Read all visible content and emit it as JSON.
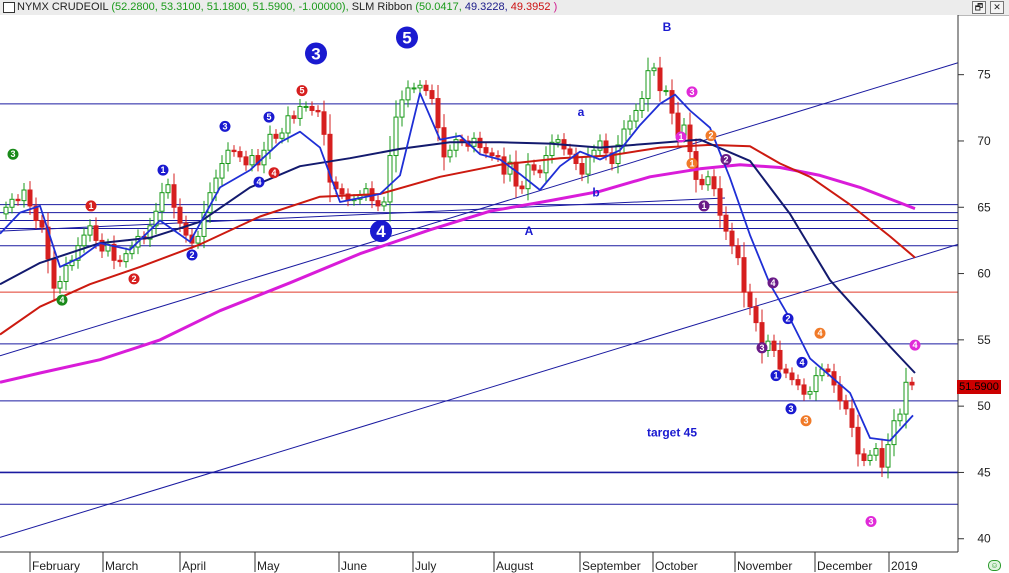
{
  "window": {
    "symbol_label": "NYMX CRUDEOIL",
    "ohlc_text": "(52.2800, 53.3100, 51.1800, 51.5900, -1.00000),",
    "ribbon_label": "SLM Ribbon",
    "ribbon_v1": "(50.0417,",
    "ribbon_v2": "49.3228,",
    "ribbon_v3": "49.3952",
    "ribbon_close": ")",
    "restore_label": "🗗",
    "close_label": "✕",
    "status_icon": "☺"
  },
  "colors": {
    "up": "#1a9a1a",
    "down": "#d61f1f",
    "navy": "#131a6e",
    "blue": "#1f2fd6",
    "red_ma": "#cc1a10",
    "magenta": "#d91cd9",
    "hline": "#1a1aa0",
    "channel": "#1a1aa0"
  },
  "chart_data": {
    "type": "line",
    "title": "",
    "xlabel": "",
    "ylabel": "",
    "ylim": [
      39.0,
      79.5
    ],
    "y_ticks": [
      40,
      45,
      50,
      55,
      60,
      65,
      70,
      75
    ],
    "months": [
      "February",
      "March",
      "April",
      "May",
      "June",
      "July",
      "August",
      "September",
      "October",
      "November",
      "December",
      "2019"
    ],
    "last_price": "51.5900",
    "horizontal_levels": [
      72.8,
      65.2,
      64.6,
      64.0,
      63.4,
      62.1,
      54.7,
      50.4,
      45.0,
      42.6
    ],
    "red_level": 58.6,
    "channel_lines": [
      {
        "from": [
          0,
          53.8
        ],
        "to": [
          958,
          75.9
        ]
      },
      {
        "from": [
          0,
          40.1
        ],
        "to": [
          958,
          62.2
        ]
      }
    ],
    "b_line": {
      "from": [
        0,
        63.2
      ],
      "to": [
        725,
        65.7
      ]
    },
    "series": [
      {
        "name": "",
        "role": "ma_magenta",
        "x": [
          0,
          40,
          100,
          160,
          220,
          290,
          360,
          430,
          490,
          550,
          600,
          650,
          700,
          740,
          780,
          820,
          860,
          915
        ],
        "values": [
          51.8,
          52.5,
          53.5,
          55.0,
          57.2,
          59.3,
          61.5,
          63.3,
          64.7,
          65.5,
          66.2,
          67.3,
          67.9,
          68.2,
          68.0,
          67.4,
          66.5,
          64.9
        ]
      },
      {
        "name": "",
        "role": "ma_red",
        "x": [
          0,
          40,
          90,
          140,
          200,
          260,
          320,
          380,
          440,
          500,
          560,
          610,
          660,
          710,
          750,
          780,
          810,
          850,
          890,
          915
        ],
        "values": [
          55.4,
          57.5,
          59.2,
          60.5,
          62.2,
          64.3,
          65.8,
          66.0,
          67.3,
          68.2,
          68.7,
          68.9,
          69.5,
          69.7,
          69.6,
          68.3,
          67.3,
          65.2,
          62.8,
          61.2
        ]
      },
      {
        "name": "",
        "role": "ma_navy",
        "x": [
          0,
          40,
          100,
          150,
          200,
          250,
          300,
          350,
          400,
          450,
          500,
          550,
          600,
          650,
          700,
          750,
          790,
          830,
          860,
          890,
          915
        ],
        "values": [
          59.2,
          60.8,
          62.3,
          62.7,
          63.9,
          66.5,
          68.1,
          68.7,
          69.4,
          69.9,
          69.9,
          69.8,
          69.5,
          69.8,
          70.1,
          68.5,
          64.5,
          59.5,
          57.0,
          54.5,
          52.5
        ]
      },
      {
        "name": "",
        "role": "ma_blue",
        "x": [
          0,
          20,
          40,
          60,
          80,
          100,
          130,
          160,
          190,
          220,
          250,
          280,
          300,
          320,
          340,
          360,
          380,
          400,
          420,
          440,
          460,
          480,
          500,
          520,
          540,
          560,
          580,
          600,
          620,
          640,
          660,
          675,
          690,
          710,
          730,
          750,
          770,
          790,
          810,
          830,
          850,
          870,
          890,
          913
        ],
        "values": [
          63.0,
          64.6,
          65.1,
          60.5,
          61.2,
          62.3,
          61.8,
          64.0,
          62.4,
          66.5,
          67.8,
          69.9,
          70.7,
          69.5,
          65.4,
          65.7,
          66.0,
          67.4,
          73.6,
          70.1,
          70.4,
          69.0,
          68.6,
          67.5,
          66.3,
          68.1,
          69.2,
          68.6,
          69.3,
          71.2,
          72.8,
          73.5,
          72.3,
          71.0,
          67.2,
          62.9,
          59.2,
          56.6,
          53.6,
          52.3,
          51.0,
          47.6,
          47.4,
          49.3
        ]
      }
    ],
    "candles": {
      "x": [
        6,
        12,
        18,
        24,
        30,
        36,
        42,
        48,
        54,
        60,
        66,
        72,
        78,
        84,
        90,
        96,
        102,
        108,
        114,
        120,
        126,
        132,
        138,
        144,
        150,
        156,
        162,
        168,
        174,
        180,
        186,
        192,
        198,
        204,
        210,
        216,
        222,
        228,
        234,
        240,
        246,
        252,
        258,
        264,
        270,
        276,
        282,
        288,
        294,
        300,
        306,
        312,
        318,
        324,
        330,
        336,
        342,
        348,
        354,
        360,
        366,
        372,
        378,
        384,
        390,
        396,
        402,
        408,
        414,
        420,
        426,
        432,
        438,
        444,
        450,
        456,
        462,
        468,
        474,
        480,
        486,
        492,
        498,
        504,
        510,
        516,
        522,
        528,
        534,
        540,
        546,
        552,
        558,
        564,
        570,
        576,
        582,
        588,
        594,
        600,
        606,
        612,
        618,
        624,
        630,
        636,
        642,
        648,
        654,
        660,
        666,
        672,
        678,
        684,
        690,
        696,
        702,
        708,
        714,
        720,
        726,
        732,
        738,
        744,
        750,
        756,
        762,
        768,
        774,
        780,
        786,
        792,
        798,
        804,
        810,
        816,
        822,
        828,
        834,
        840,
        846,
        852,
        858,
        864,
        870,
        876,
        882,
        888,
        894,
        900,
        906,
        912
      ],
      "close": [
        65.0,
        65.6,
        65.5,
        66.3,
        65.1,
        64.0,
        63.5,
        61.1,
        58.9,
        59.4,
        60.6,
        61.0,
        62.1,
        62.9,
        63.6,
        62.5,
        61.7,
        62.2,
        61.0,
        60.9,
        61.5,
        62.0,
        62.8,
        62.6,
        63.6,
        64.7,
        66.1,
        66.7,
        65.0,
        63.8,
        62.9,
        62.3,
        62.8,
        64.6,
        66.1,
        67.2,
        68.3,
        69.3,
        69.2,
        68.8,
        68.2,
        68.9,
        68.2,
        69.3,
        70.5,
        70.2,
        70.6,
        71.9,
        71.7,
        72.6,
        72.6,
        72.3,
        72.2,
        70.5,
        66.9,
        66.4,
        66.0,
        65.5,
        65.6,
        65.9,
        66.4,
        65.5,
        65.1,
        65.4,
        68.9,
        71.8,
        73.1,
        74.0,
        74.0,
        74.2,
        73.8,
        73.2,
        71.0,
        68.8,
        69.3,
        70.1,
        70.0,
        69.6,
        70.2,
        69.5,
        69.1,
        68.9,
        68.8,
        67.5,
        68.4,
        66.6,
        66.4,
        68.2,
        67.8,
        67.6,
        68.9,
        69.9,
        70.1,
        69.4,
        69.0,
        68.3,
        67.5,
        68.8,
        69.3,
        70.0,
        69.1,
        68.3,
        69.7,
        70.9,
        71.5,
        72.3,
        73.2,
        75.3,
        75.5,
        73.8,
        73.8,
        72.1,
        70.4,
        71.2,
        69.2,
        67.1,
        66.7,
        67.3,
        66.4,
        64.4,
        63.2,
        62.1,
        61.2,
        58.6,
        57.5,
        56.3,
        54.2,
        54.9,
        54.2,
        52.8,
        52.5,
        52.0,
        51.6,
        50.9,
        51.1,
        52.3,
        52.8,
        52.6,
        51.6,
        50.4,
        49.8,
        48.4,
        46.4,
        45.9,
        46.3,
        46.8,
        45.4,
        47.1,
        48.9,
        49.4,
        51.8,
        51.6
      ]
    },
    "annotations": [
      {
        "label": "3",
        "x": 13,
        "y": 69.0,
        "style": "sm",
        "color": "#1a8a1a"
      },
      {
        "label": "4",
        "x": 62,
        "y": 58.0,
        "style": "sm",
        "color": "#1a8a1a"
      },
      {
        "label": "1",
        "x": 91,
        "y": 65.1,
        "style": "sm",
        "color": "#d61f1f"
      },
      {
        "label": "2",
        "x": 134,
        "y": 59.6,
        "style": "sm",
        "color": "#d61f1f"
      },
      {
        "label": "1",
        "x": 163,
        "y": 67.8,
        "style": "sm",
        "color": "#1a1ad0"
      },
      {
        "label": "2",
        "x": 192,
        "y": 61.4,
        "style": "sm",
        "color": "#1a1ad0"
      },
      {
        "label": "3",
        "x": 225,
        "y": 71.1,
        "style": "sm",
        "color": "#1a1ad0"
      },
      {
        "label": "4",
        "x": 259,
        "y": 66.9,
        "style": "sm",
        "color": "#1a1ad0"
      },
      {
        "label": "5",
        "x": 269,
        "y": 71.8,
        "style": "sm",
        "color": "#1a1ad0"
      },
      {
        "label": "4",
        "x": 274,
        "y": 67.6,
        "style": "sm",
        "color": "#d61f1f"
      },
      {
        "label": "5",
        "x": 302,
        "y": 73.8,
        "style": "sm",
        "color": "#d61f1f"
      },
      {
        "label": "3",
        "x": 316,
        "y": 76.6,
        "style": "lg",
        "color": "#1a1ad0"
      },
      {
        "label": "5",
        "x": 407,
        "y": 77.8,
        "style": "lg",
        "color": "#1a1ad0"
      },
      {
        "label": "4",
        "x": 381,
        "y": 63.2,
        "style": "lg",
        "color": "#1a1ad0"
      },
      {
        "label": "1",
        "x": 681,
        "y": 70.3,
        "style": "sm",
        "color": "#e02ad8"
      },
      {
        "label": "3",
        "x": 692,
        "y": 73.7,
        "style": "sm",
        "color": "#e02ad8"
      },
      {
        "label": "2",
        "x": 711,
        "y": 70.4,
        "style": "sm",
        "color": "#f07a28"
      },
      {
        "label": "1",
        "x": 692,
        "y": 68.3,
        "style": "sm",
        "color": "#f07a28"
      },
      {
        "label": "2",
        "x": 726,
        "y": 68.6,
        "style": "sm",
        "color": "#6a1b88"
      },
      {
        "label": "1",
        "x": 704,
        "y": 65.1,
        "style": "sm",
        "color": "#6a1b88"
      },
      {
        "label": "4",
        "x": 773,
        "y": 59.3,
        "style": "sm",
        "color": "#6a1b88"
      },
      {
        "label": "3",
        "x": 762,
        "y": 54.4,
        "style": "sm",
        "color": "#6a1b88"
      },
      {
        "label": "2",
        "x": 788,
        "y": 56.6,
        "style": "sm",
        "color": "#1a1ad0"
      },
      {
        "label": "4",
        "x": 802,
        "y": 53.3,
        "style": "sm",
        "color": "#1a1ad0"
      },
      {
        "label": "1",
        "x": 776,
        "y": 52.3,
        "style": "sm",
        "color": "#1a1ad0"
      },
      {
        "label": "3",
        "x": 791,
        "y": 49.8,
        "style": "sm",
        "color": "#1a1ad0"
      },
      {
        "label": "4",
        "x": 820,
        "y": 55.5,
        "style": "sm",
        "color": "#f07a28"
      },
      {
        "label": "3",
        "x": 806,
        "y": 48.9,
        "style": "sm",
        "color": "#f07a28"
      },
      {
        "label": "4",
        "x": 915,
        "y": 54.6,
        "style": "sm",
        "color": "#e02ad8"
      },
      {
        "label": "3",
        "x": 871,
        "y": 41.3,
        "style": "sm",
        "color": "#e02ad8"
      }
    ],
    "text_labels": [
      {
        "label": "B",
        "x": 667,
        "y": 78.3,
        "color": "#1a1ad0"
      },
      {
        "label": "a",
        "x": 581,
        "y": 71.9,
        "color": "#1a1ad0"
      },
      {
        "label": "b",
        "x": 596,
        "y": 65.8,
        "color": "#1a1ad0"
      },
      {
        "label": "A",
        "x": 529,
        "y": 62.9,
        "color": "#1a1ad0"
      },
      {
        "label": "target 45",
        "x": 672,
        "y": 47.7,
        "color": "#1a1ad0"
      }
    ]
  }
}
